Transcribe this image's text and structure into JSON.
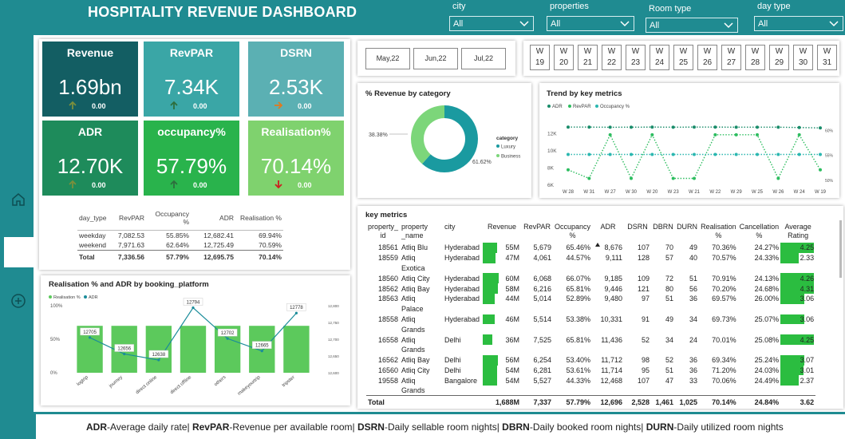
{
  "header": {
    "title": "HOSPITALITY REVENUE DASHBOARD",
    "filters": [
      {
        "label": "city",
        "value": "All"
      },
      {
        "label": "properties",
        "value": "All"
      },
      {
        "label": "Room type",
        "value": "All"
      },
      {
        "label": "day type",
        "value": "All"
      }
    ]
  },
  "kpis": [
    {
      "title": "Revenue",
      "value": "1.69bn",
      "change": "0.00",
      "arrow": "up",
      "bg": "#135e63",
      "arrow_color": "#7b8f3c"
    },
    {
      "title": "RevPAR",
      "value": "7.34K",
      "change": "0.00",
      "arrow": "up",
      "bg": "#3aa6a6",
      "arrow_color": "#2e6e3e"
    },
    {
      "title": "DSRN",
      "value": "2.53K",
      "change": "0.00",
      "arrow": "right",
      "bg": "#5bb0b3",
      "arrow_color": "#e07a1f"
    },
    {
      "title": "ADR",
      "value": "12.70K",
      "change": "0.00",
      "arrow": "up",
      "bg": "#1e8b5b",
      "arrow_color": "#7b8f3c"
    },
    {
      "title": "occupancy%",
      "value": "57.79%",
      "change": "0.00",
      "arrow": "up",
      "bg": "#29b34c",
      "arrow_color": "#2e6e3e"
    },
    {
      "title": "Realisation%",
      "value": "70.14%",
      "change": "0.00",
      "arrow": "down",
      "bg": "#7fd26e",
      "arrow_color": "#cc1f1f"
    }
  ],
  "day_type_table": {
    "headers": [
      "day_type",
      "RevPAR",
      "Occupancy %",
      "ADR",
      "Realisation %"
    ],
    "rows": [
      [
        "weekday",
        "7,082.53",
        "55.85%",
        "12,682.41",
        "69.94%"
      ],
      [
        "weekend",
        "7,971.63",
        "62.64%",
        "12,725.49",
        "70.59%"
      ]
    ],
    "total": [
      "Total",
      "7,336.56",
      "57.79%",
      "12,695.75",
      "70.14%"
    ]
  },
  "months": [
    "May,22",
    "Jun,22",
    "Jul,22"
  ],
  "weeks": [
    "W 19",
    "W 20",
    "W 21",
    "W 22",
    "W 23",
    "W 24",
    "W 25",
    "W 26",
    "W 27",
    "W 28",
    "W 29",
    "W 30",
    "W 31"
  ],
  "revenue_by_category": {
    "title": "% Revenue by category",
    "legend_title": "category",
    "label_business": "38.38%",
    "label_luxury": "61.62%"
  },
  "trend": {
    "title": "Trend by key metrics"
  },
  "booking": {
    "title": "Realisation % and ADR by booking_platform"
  },
  "key_metrics": {
    "title": "key metrics",
    "headers": [
      "property_ id",
      "property _name",
      "city",
      "Revenue",
      "RevPAR",
      "Occupancy %",
      "ADR",
      "DSRN",
      "DBRN",
      "DURN",
      "Realisation %",
      "Cancellation %",
      "Average Rating"
    ],
    "rows": [
      [
        "18561",
        "Atliq Blu",
        "Hyderabad",
        "55M",
        "5,679",
        "65.46%",
        "8,676",
        "107",
        "70",
        "49",
        "70.36%",
        "24.27%",
        "4.25"
      ],
      [
        "18559",
        "Atliq",
        "Hyderabad",
        "47M",
        "4,061",
        "44.57%",
        "9,111",
        "128",
        "57",
        "40",
        "70.57%",
        "24.33%",
        "2.33"
      ],
      [
        "",
        "Exotica",
        "",
        "",
        "",
        "",
        "",
        "",
        "",
        "",
        "",
        "",
        ""
      ],
      [
        "18560",
        "Atliq City",
        "Hyderabad",
        "60M",
        "6,068",
        "66.07%",
        "9,185",
        "109",
        "72",
        "51",
        "70.91%",
        "24.13%",
        "4.26"
      ],
      [
        "18562",
        "Atliq Bay",
        "Hyderabad",
        "58M",
        "6,216",
        "65.81%",
        "9,446",
        "121",
        "80",
        "56",
        "70.20%",
        "24.68%",
        "4.31"
      ],
      [
        "18563",
        "Atliq",
        "Hyderabad",
        "44M",
        "5,014",
        "52.89%",
        "9,480",
        "97",
        "51",
        "36",
        "69.57%",
        "26.00%",
        "3.06"
      ],
      [
        "",
        "Palace",
        "",
        "",
        "",
        "",
        "",
        "",
        "",
        "",
        "",
        "",
        ""
      ],
      [
        "18558",
        "Atliq",
        "Hyderabad",
        "46M",
        "5,514",
        "53.38%",
        "10,331",
        "91",
        "49",
        "34",
        "69.73%",
        "25.07%",
        "3.06"
      ],
      [
        "",
        "Grands",
        "",
        "",
        "",
        "",
        "",
        "",
        "",
        "",
        "",
        "",
        ""
      ],
      [
        "16558",
        "Atliq",
        "Delhi",
        "36M",
        "7,525",
        "65.81%",
        "11,436",
        "52",
        "34",
        "24",
        "70.01%",
        "25.08%",
        "4.25"
      ],
      [
        "",
        "Grands",
        "",
        "",
        "",
        "",
        "",
        "",
        "",
        "",
        "",
        "",
        ""
      ],
      [
        "16562",
        "Atliq Bay",
        "Delhi",
        "56M",
        "6,254",
        "53.40%",
        "11,712",
        "98",
        "52",
        "36",
        "69.34%",
        "25.24%",
        "3.07"
      ],
      [
        "16560",
        "Atliq City",
        "Delhi",
        "54M",
        "6,281",
        "53.61%",
        "11,714",
        "95",
        "51",
        "36",
        "71.20%",
        "24.03%",
        "3.01"
      ],
      [
        "19558",
        "Atliq",
        "Bangalore",
        "54M",
        "5,527",
        "44.33%",
        "12,468",
        "107",
        "47",
        "33",
        "70.06%",
        "24.49%",
        "2.37"
      ],
      [
        "",
        "Grands",
        "",
        "",
        "",
        "",
        "",
        "",
        "",
        "",
        "",
        "",
        ""
      ]
    ],
    "total": [
      "Total",
      "",
      "",
      "1,688M",
      "7,337",
      "57.79%",
      "12,696",
      "2,528",
      "1,461",
      "1,025",
      "70.14%",
      "24.84%",
      "3.62"
    ]
  },
  "footer": {
    "segments": [
      {
        "b": "ADR",
        "t": "-Average daily rate| "
      },
      {
        "b": "RevPAR",
        "t": "-Revenue per available room| "
      },
      {
        "b": "DSRN",
        "t": "-Daily sellable room nights| "
      },
      {
        "b": "DBRN",
        "t": "-Daily booked room nights| "
      },
      {
        "b": "DURN",
        "t": "-Daily utilized room nights"
      }
    ]
  },
  "chart_data": [
    {
      "type": "pie",
      "title": "% Revenue by category",
      "categories": [
        "Luxury",
        "Business"
      ],
      "values": [
        61.62,
        38.38
      ],
      "colors": [
        "#1a9aa0",
        "#7cd67a"
      ],
      "legend": "right"
    },
    {
      "type": "line",
      "title": "Trend by key metrics",
      "categories": [
        "W 28",
        "W 31",
        "W 27",
        "W 30",
        "W 20",
        "W 23",
        "W 21",
        "W 22",
        "W 29",
        "W 25",
        "W 26",
        "W 24",
        "W 19"
      ],
      "y_ticks": [
        "12K",
        "10K",
        "8K",
        "6K"
      ],
      "y2_ticks": [
        "60%",
        "55%",
        "50%"
      ],
      "ylim": [
        6000,
        13000
      ],
      "y2lim": [
        49,
        61
      ],
      "series": [
        {
          "name": "ADR",
          "axis": "left",
          "color": "#1a8c6a",
          "values": [
            12700,
            12700,
            12680,
            12690,
            12700,
            12690,
            12700,
            12700,
            12690,
            12690,
            12690,
            12650,
            12600
          ]
        },
        {
          "name": "RevPAR",
          "axis": "left",
          "color": "#2dbd5f",
          "values": [
            7700,
            6700,
            11800,
            6700,
            11800,
            6700,
            6700,
            11800,
            11800,
            11800,
            6700,
            11800,
            7700
          ]
        },
        {
          "name": "Occupancy %",
          "axis": "right",
          "color": "#2bb7b0",
          "values": [
            55,
            55,
            55,
            55,
            55,
            55,
            55,
            55,
            55,
            55,
            55,
            55,
            55
          ]
        }
      ],
      "legend": "top-left"
    },
    {
      "type": "bar",
      "title": "Realisation % and ADR by booking_platform",
      "categories": [
        "logtrip",
        "journey",
        "direct online",
        "direct offline",
        "others",
        "makeyourtrip",
        "tripster"
      ],
      "y_ticks": [
        "100%",
        "50%",
        "0%"
      ],
      "y2_ticks": [
        "12,800",
        "12,750",
        "12,700",
        "12,650",
        "12,600"
      ],
      "ylim": [
        0,
        100
      ],
      "y2lim": [
        12600,
        12800
      ],
      "series": [
        {
          "name": "Realisation %",
          "type": "bar",
          "axis": "left",
          "color": "#5cc95c",
          "values": [
            70,
            70,
            70,
            70,
            70,
            70,
            70
          ]
        },
        {
          "name": "ADR",
          "type": "line",
          "axis": "right",
          "color": "#1a8c9a",
          "values": [
            12705,
            12656,
            12638,
            12794,
            12702,
            12665,
            12778
          ],
          "labels": [
            "12705",
            "12656",
            "12638",
            "12794",
            "12702",
            "12665",
            "12778"
          ]
        }
      ],
      "legend": "top-left"
    }
  ]
}
